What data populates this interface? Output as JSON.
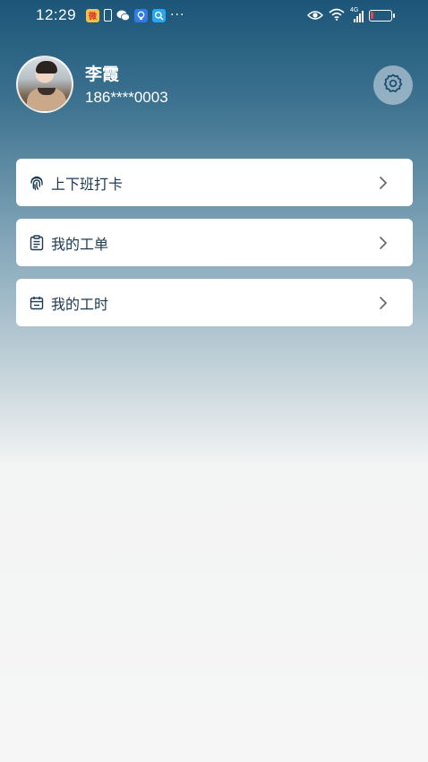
{
  "status_bar": {
    "time": "12:29",
    "weibo_glyph": "微",
    "more_glyph": "···",
    "network_label": "4G",
    "icons": [
      "weibo-icon",
      "phone-icon",
      "wechat-icon",
      "bulb-app-icon",
      "search-app-icon",
      "more-icon",
      "eye-icon",
      "wifi-icon",
      "signal-icon",
      "battery-icon"
    ]
  },
  "profile": {
    "name": "李霞",
    "phone": "186****0003"
  },
  "menu": {
    "items": [
      {
        "label": "上下班打卡",
        "icon": "fingerprint-icon"
      },
      {
        "label": "我的工单",
        "icon": "clipboard-icon"
      },
      {
        "label": "我的工时",
        "icon": "calendar-icon"
      }
    ]
  },
  "colors": {
    "header_top": "#1b5578",
    "page_bottom": "#f6f6f6",
    "card_text": "#1d3a52"
  }
}
